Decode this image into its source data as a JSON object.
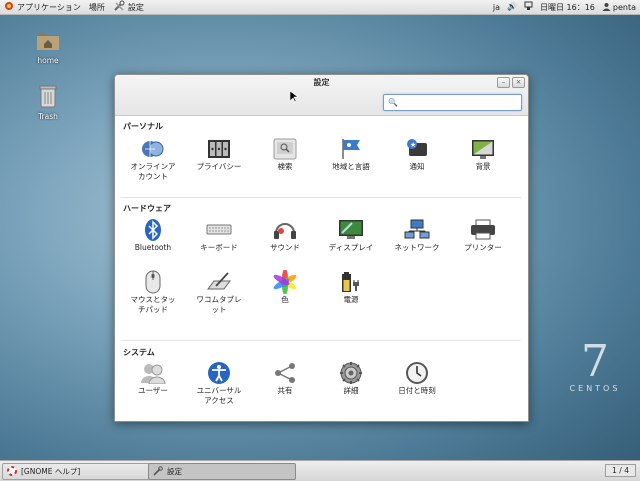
{
  "topbar": {
    "applications": "アプリケーション",
    "places": "場所",
    "current_app": "設定",
    "lang": "ja",
    "datetime": "日曜日 16：16",
    "user": "penta"
  },
  "desktop": {
    "home_label": "home",
    "trash_label": "Trash"
  },
  "window": {
    "title": "設定",
    "search_placeholder": "",
    "sections": [
      {
        "title": "パーソナル",
        "items": [
          {
            "label": "オンラインア\nカウント",
            "icon": "online-accounts-icon"
          },
          {
            "label": "プライバシー",
            "icon": "privacy-icon"
          },
          {
            "label": "検索",
            "icon": "search-icon"
          },
          {
            "label": "地域と言語",
            "icon": "region-language-icon"
          },
          {
            "label": "通知",
            "icon": "notifications-icon"
          },
          {
            "label": "背景",
            "icon": "background-icon"
          }
        ]
      },
      {
        "title": "ハードウェア",
        "items": [
          {
            "label": "Bluetooth",
            "icon": "bluetooth-icon"
          },
          {
            "label": "キーボード",
            "icon": "keyboard-icon"
          },
          {
            "label": "サウンド",
            "icon": "sound-icon"
          },
          {
            "label": "ディスプレイ",
            "icon": "display-icon"
          },
          {
            "label": "ネットワーク",
            "icon": "network-icon"
          },
          {
            "label": "プリンター",
            "icon": "printer-icon"
          },
          {
            "label": "マウスとタッ\nチパッド",
            "icon": "mouse-icon"
          },
          {
            "label": "ワコムタブレ\nット",
            "icon": "wacom-tablet-icon"
          },
          {
            "label": "色",
            "icon": "color-icon"
          },
          {
            "label": "電源",
            "icon": "power-icon"
          }
        ]
      },
      {
        "title": "システム",
        "items": [
          {
            "label": "ユーザー",
            "icon": "users-icon"
          },
          {
            "label": "ユニバーサル\nアクセス",
            "icon": "universal-access-icon"
          },
          {
            "label": "共有",
            "icon": "sharing-icon"
          },
          {
            "label": "詳細",
            "icon": "details-icon"
          },
          {
            "label": "日付と時刻",
            "icon": "date-time-icon"
          }
        ]
      }
    ]
  },
  "bottombar": {
    "task1": "[GNOME ヘルプ]",
    "task2": "設定",
    "pager": "1 / 4"
  },
  "branding": {
    "seven": "7",
    "word": "CENTOS"
  },
  "colors": {
    "accent": "#4a90d9",
    "desktop": "#5f8ca8"
  }
}
